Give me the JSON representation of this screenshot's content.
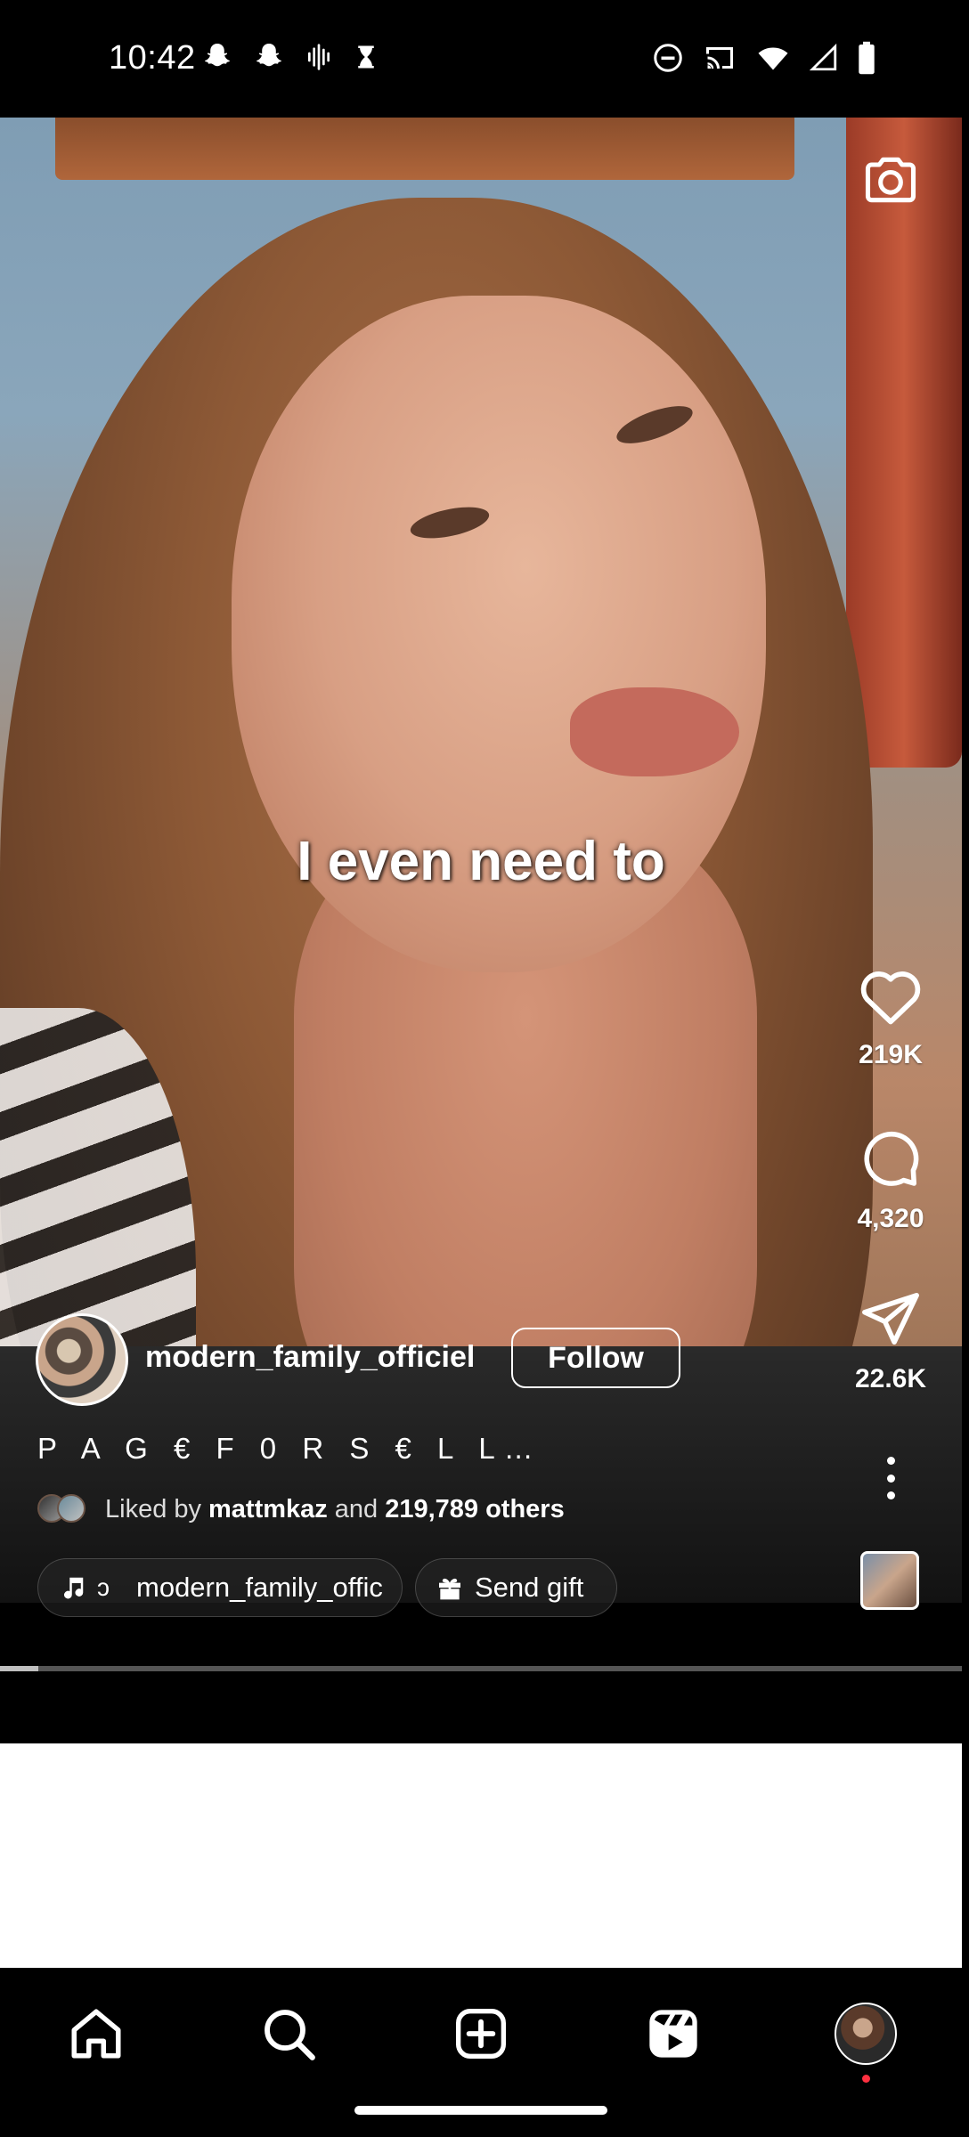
{
  "status_bar": {
    "time": "10:42",
    "left_icons": [
      "snapchat-icon",
      "snapchat-icon",
      "voice-icon",
      "hourglass-icon"
    ],
    "right_icons": [
      "dnd-icon",
      "cast-icon",
      "wifi-icon",
      "signal-icon",
      "battery-icon"
    ]
  },
  "video": {
    "subtitle": "I even need to",
    "progress_fraction": 0.04
  },
  "actions": {
    "like_count": "219K",
    "comment_count": "4,320",
    "share_count": "22.6K"
  },
  "author": {
    "username": "modern_family_officiel",
    "follow_label": "Follow"
  },
  "caption": "P A G € F 0 R S € L L…",
  "liked_by": {
    "prefix": "Liked by",
    "user": "mattmkaz",
    "middle": "and",
    "others": "219,789 others"
  },
  "audio": {
    "prefix": "ɔ",
    "label": "modern_family_offic"
  },
  "gift": {
    "label": "Send gift"
  },
  "colors": {
    "background": "#000000",
    "notification_dot": "#ff3040"
  },
  "nav": [
    "home-icon",
    "search-icon",
    "create-icon",
    "reels-icon",
    "profile-avatar"
  ]
}
